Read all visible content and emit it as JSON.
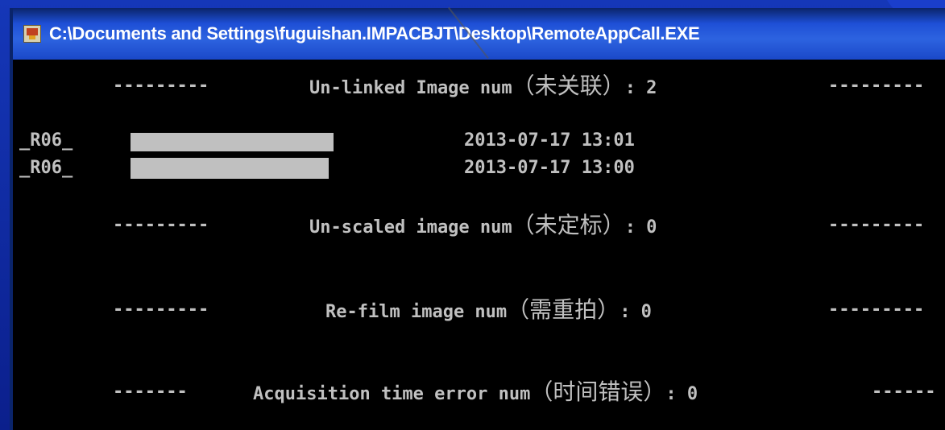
{
  "window": {
    "title": "C:\\Documents and Settings\\fuguishan.IMPACBJT\\Desktop\\RemoteAppCall.EXE"
  },
  "console": {
    "unlinked": {
      "dashes_left": "---------",
      "label": "Un-linked Image num",
      "cjk": "（未关联）",
      "value": ": 2",
      "dashes_right": "---------"
    },
    "rows": [
      {
        "id": "_R06_",
        "time": "2013-07-17 13:01"
      },
      {
        "id": "_R06_",
        "time": "2013-07-17 13:00"
      }
    ],
    "unscaled": {
      "dashes_left": "---------",
      "label": "Un-scaled image num",
      "cjk": "（未定标）",
      "value": ": 0",
      "dashes_right": "---------"
    },
    "refilm": {
      "dashes_left": "---------",
      "label": "Re-film image num",
      "cjk": "（需重拍）",
      "value": ": 0",
      "dashes_right": "---------"
    },
    "acq": {
      "dashes_left": "-------",
      "label": "Acquisition time error num",
      "cjk": "（时间错误）",
      "value": ": 0",
      "dashes_right": "------"
    }
  },
  "colors": {
    "console_bg": "#000000",
    "console_text": "#c0c0c0",
    "titlebar": "#1e4fd6",
    "slide_bg": "#0b1f8c"
  }
}
